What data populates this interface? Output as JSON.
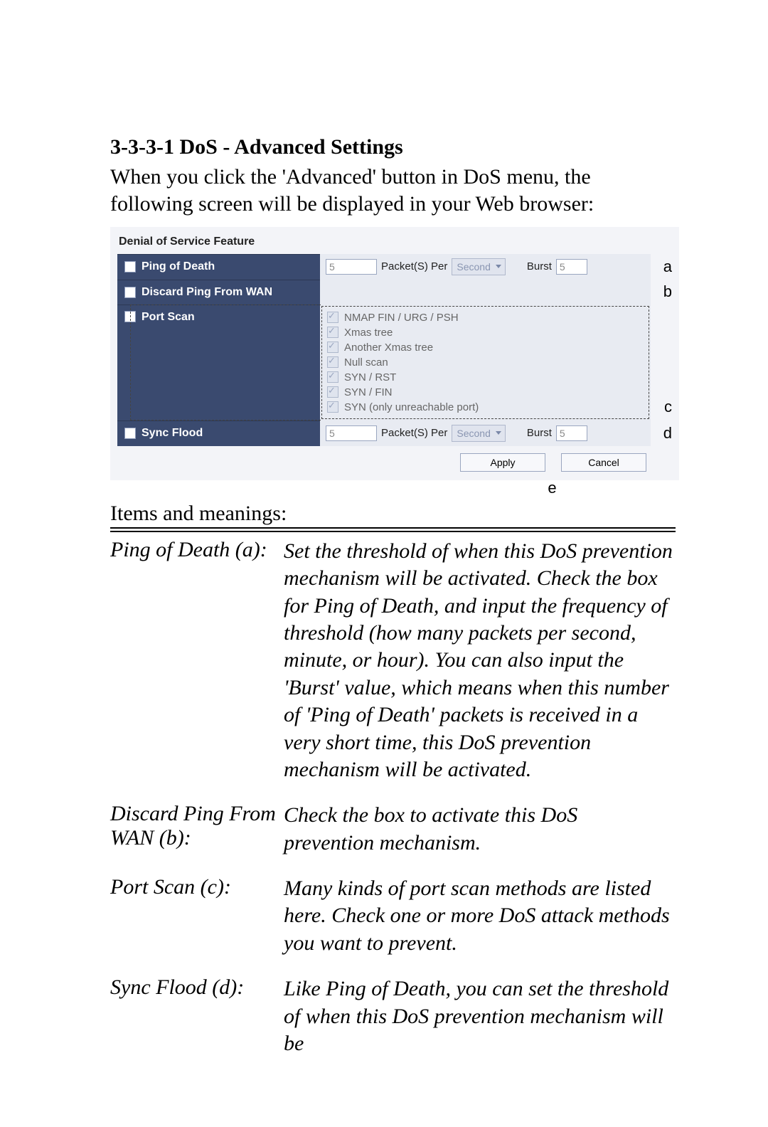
{
  "heading": "3-3-3-1 DoS - Advanced Settings",
  "intro": "When you click the 'Advanced' button in DoS menu, the following screen will be displayed in your Web browser:",
  "screenshot": {
    "title": "Denial of Service Feature",
    "rows": {
      "ping_of_death": {
        "label": "Ping of Death",
        "value": "5",
        "packets_label": "Packet(S) Per",
        "unit": "Second",
        "burst_label": "Burst",
        "burst_value": "5",
        "letter": "a"
      },
      "discard_wan": {
        "label": "Discard Ping From WAN",
        "letter": "b"
      },
      "port_scan": {
        "label": "Port Scan",
        "letter": "c",
        "items": [
          "NMAP FIN / URG / PSH",
          "Xmas tree",
          "Another Xmas tree",
          "Null scan",
          "SYN / RST",
          "SYN / FIN",
          "SYN (only unreachable port)"
        ]
      },
      "sync_flood": {
        "label": "Sync Flood",
        "value": "5",
        "packets_label": "Packet(S) Per",
        "unit": "Second",
        "burst_label": "Burst",
        "burst_value": "5",
        "letter": "d"
      }
    },
    "buttons": {
      "apply": "Apply",
      "cancel": "Cancel",
      "letter_e": "e"
    }
  },
  "items_label": "Items and meanings:",
  "items": [
    {
      "term": "Ping of Death (a):",
      "def": "Set the threshold of when this DoS prevention mechanism will be activated. Check the box for Ping of Death, and input the frequency of threshold (how many packets per second, minute, or hour). You can also input the 'Burst' value, which means when this number of 'Ping of Death' packets is received in a very short time, this DoS prevention mechanism will be activated."
    },
    {
      "term": "Discard Ping From WAN (b):",
      "def": "Check the box to activate this DoS prevention mechanism."
    },
    {
      "term": "Port Scan (c):",
      "def": "Many kinds of port scan methods are listed here. Check one or more DoS attack methods you want to prevent."
    },
    {
      "term": "Sync Flood (d):",
      "def": "Like Ping of Death, you can set the threshold of when this DoS prevention mechanism will be"
    }
  ]
}
